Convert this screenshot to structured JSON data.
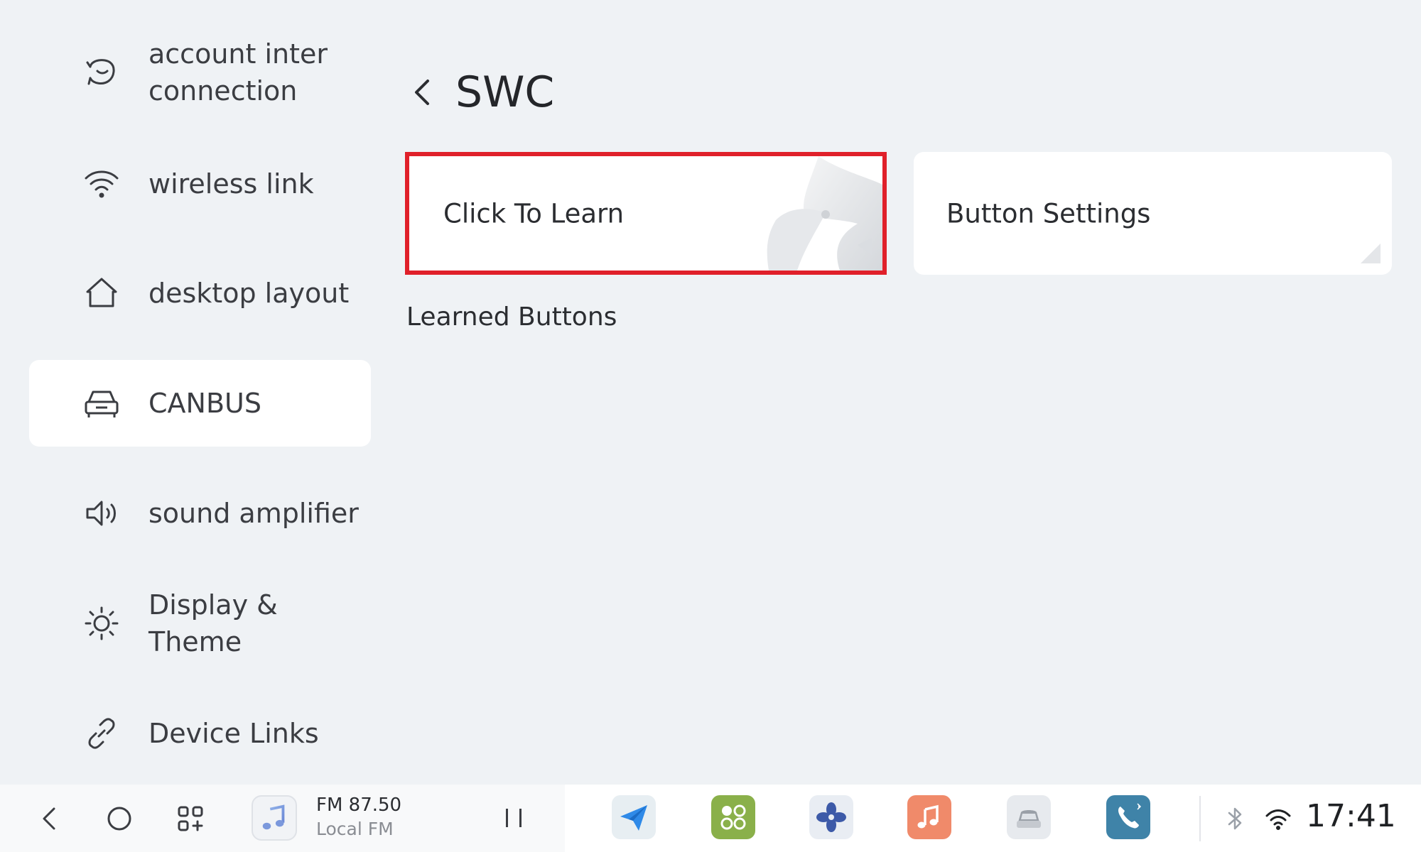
{
  "sidebar": {
    "items": [
      {
        "label": "account inter connection",
        "icon": "account-link-icon"
      },
      {
        "label": "wireless link",
        "icon": "wifi-icon"
      },
      {
        "label": "desktop layout",
        "icon": "home-icon"
      },
      {
        "label": "CANBUS",
        "icon": "car-icon",
        "active": true
      },
      {
        "label": "sound amplifier",
        "icon": "speaker-icon"
      },
      {
        "label": "Display & Theme",
        "icon": "sun-icon"
      },
      {
        "label": "Device Links",
        "icon": "link-icon"
      }
    ]
  },
  "header": {
    "title": "SWC",
    "back_icon": "chevron-left-icon"
  },
  "cards": {
    "learn": {
      "label": "Click To Learn",
      "highlight_color": "#e0202a"
    },
    "settings": {
      "label": "Button Settings"
    }
  },
  "section": {
    "learned_label": "Learned Buttons"
  },
  "taskbar": {
    "nav": [
      "back-icon",
      "home-circle-icon",
      "apps-grid-icon"
    ],
    "radio": {
      "frequency": "FM 87.50",
      "station": "Local FM"
    },
    "apps": [
      {
        "name": "navigation-app",
        "color": "#e7eef2"
      },
      {
        "name": "apps-app",
        "color": "#8ab04a"
      },
      {
        "name": "fan-app",
        "color": "#e9edf3"
      },
      {
        "name": "music-app",
        "color": "#f08a6a"
      },
      {
        "name": "car-app",
        "color": "#e7eaee"
      },
      {
        "name": "phone-app",
        "color": "#3f83a8"
      }
    ],
    "clock": "17:41"
  }
}
